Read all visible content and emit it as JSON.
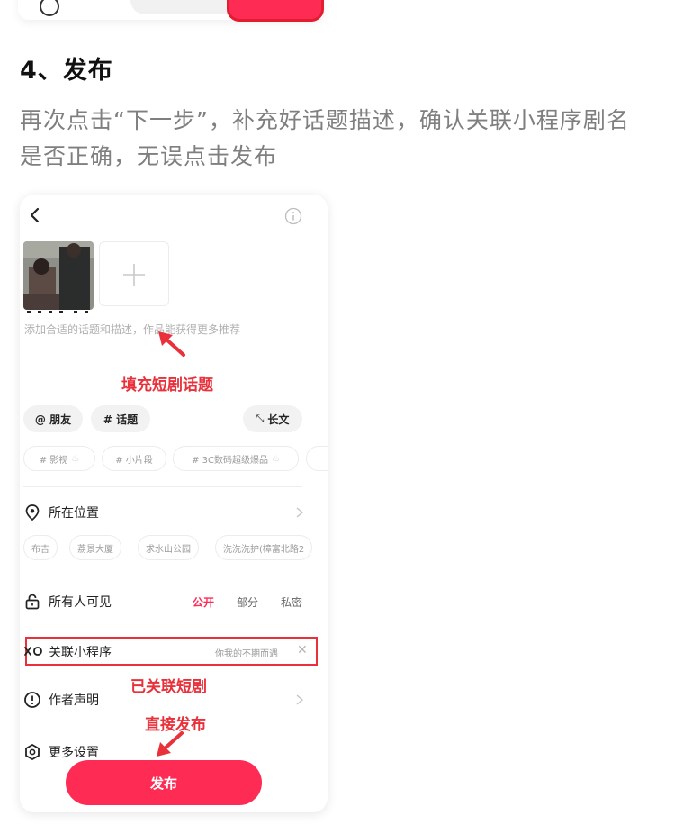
{
  "step": {
    "title": "4、发布",
    "description": "再次点击“下一步”，补充好话题描述，确认关联小程序剧名是否正确，无误点击发布"
  },
  "editor": {
    "topic_placeholder": "添加合适的话题和描述，作品能获得更多推荐",
    "tools": {
      "friends": "@ 朋友",
      "topic": "# 话题",
      "long_text": "长文"
    },
    "hashtags": [
      "# 影视",
      "# 小片段",
      "# 3C数码超级爆品"
    ],
    "location": {
      "label": "所在位置",
      "suggestions": [
        "布吉",
        "荔景大厦",
        "求水山公园",
        "洗洗洗护(樟富北路2"
      ]
    },
    "visibility": {
      "label": "所有人可见",
      "options": [
        "公开",
        "部分",
        "私密"
      ],
      "selected": "公开"
    },
    "mini_program": {
      "label": "关联小程序",
      "value": "你我的不期而遇"
    },
    "author_statement": "作者声明",
    "more_settings": "更多设置",
    "publish_label": "发布"
  },
  "annotations": {
    "fill_topic": "填充短剧话题",
    "linked_drama": "已关联短剧",
    "publish_direct": "直接发布"
  },
  "colors": {
    "accent": "#fe2c55",
    "annotation": "#e8313b"
  }
}
